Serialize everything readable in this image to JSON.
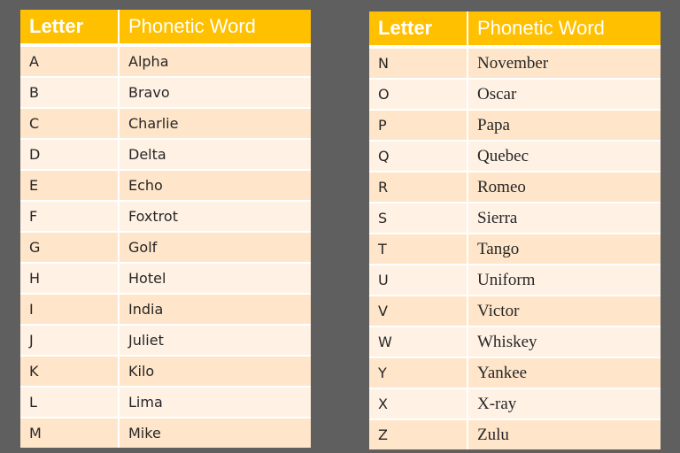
{
  "colors": {
    "background": "#5f5f5f",
    "header": "#ffc000",
    "row_odd": "#ffe5c9",
    "row_even": "#fff2e5",
    "text": "#262626"
  },
  "tables": [
    {
      "headers": [
        "Letter",
        "Phonetic Word"
      ],
      "rows": [
        [
          "A",
          "Alpha"
        ],
        [
          "B",
          "Bravo"
        ],
        [
          "C",
          "Charlie"
        ],
        [
          "D",
          "Delta"
        ],
        [
          "E",
          "Echo"
        ],
        [
          "F",
          "Foxtrot"
        ],
        [
          "G",
          "Golf"
        ],
        [
          "H",
          "Hotel"
        ],
        [
          "I",
          "India"
        ],
        [
          "J",
          "Juliet"
        ],
        [
          "K",
          "Kilo"
        ],
        [
          "L",
          "Lima"
        ],
        [
          "M",
          "Mike"
        ]
      ]
    },
    {
      "headers": [
        "Letter",
        "Phonetic Word"
      ],
      "rows": [
        [
          "N",
          "November"
        ],
        [
          "O",
          "Oscar"
        ],
        [
          "P",
          "Papa"
        ],
        [
          "Q",
          "Quebec"
        ],
        [
          "R",
          "Romeo"
        ],
        [
          "S",
          "Sierra"
        ],
        [
          "T",
          "Tango"
        ],
        [
          "U",
          "Uniform"
        ],
        [
          "V",
          "Victor"
        ],
        [
          "W",
          "Whiskey"
        ],
        [
          "Y",
          "Yankee"
        ],
        [
          "X",
          "X-ray"
        ],
        [
          "Z",
          "Zulu"
        ]
      ]
    }
  ]
}
